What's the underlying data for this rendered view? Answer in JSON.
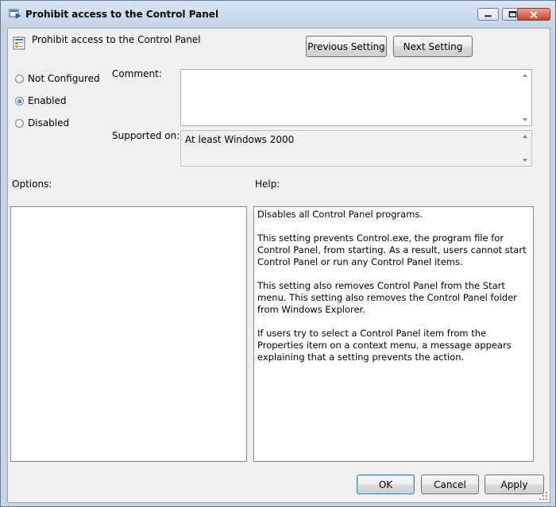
{
  "window": {
    "title": "Prohibit access to the Control Panel"
  },
  "header": {
    "policy_title": "Prohibit access to the Control Panel",
    "previous_label": "Previous Setting",
    "next_label": "Next Setting"
  },
  "state": {
    "options": [
      {
        "label": "Not Configured",
        "checked": false
      },
      {
        "label": "Enabled",
        "checked": true
      },
      {
        "label": "Disabled",
        "checked": false
      }
    ]
  },
  "comment": {
    "label": "Comment:",
    "value": ""
  },
  "supported": {
    "label": "Supported on:",
    "value": "At least Windows 2000"
  },
  "options_label": "Options:",
  "help_label": "Help:",
  "help": {
    "paragraphs": [
      "Disables all Control Panel programs.",
      "This setting prevents Control.exe, the program file for Control Panel, from starting. As a result, users cannot start Control Panel or run any Control Panel items.",
      "This setting also removes Control Panel from the Start menu. This setting also removes the Control Panel folder from Windows Explorer.",
      "If users try to select a Control Panel item from the Properties item on a context menu, a message appears explaining that a setting prevents the action."
    ]
  },
  "footer": {
    "ok_label": "OK",
    "cancel_label": "Cancel",
    "apply_label": "Apply"
  }
}
